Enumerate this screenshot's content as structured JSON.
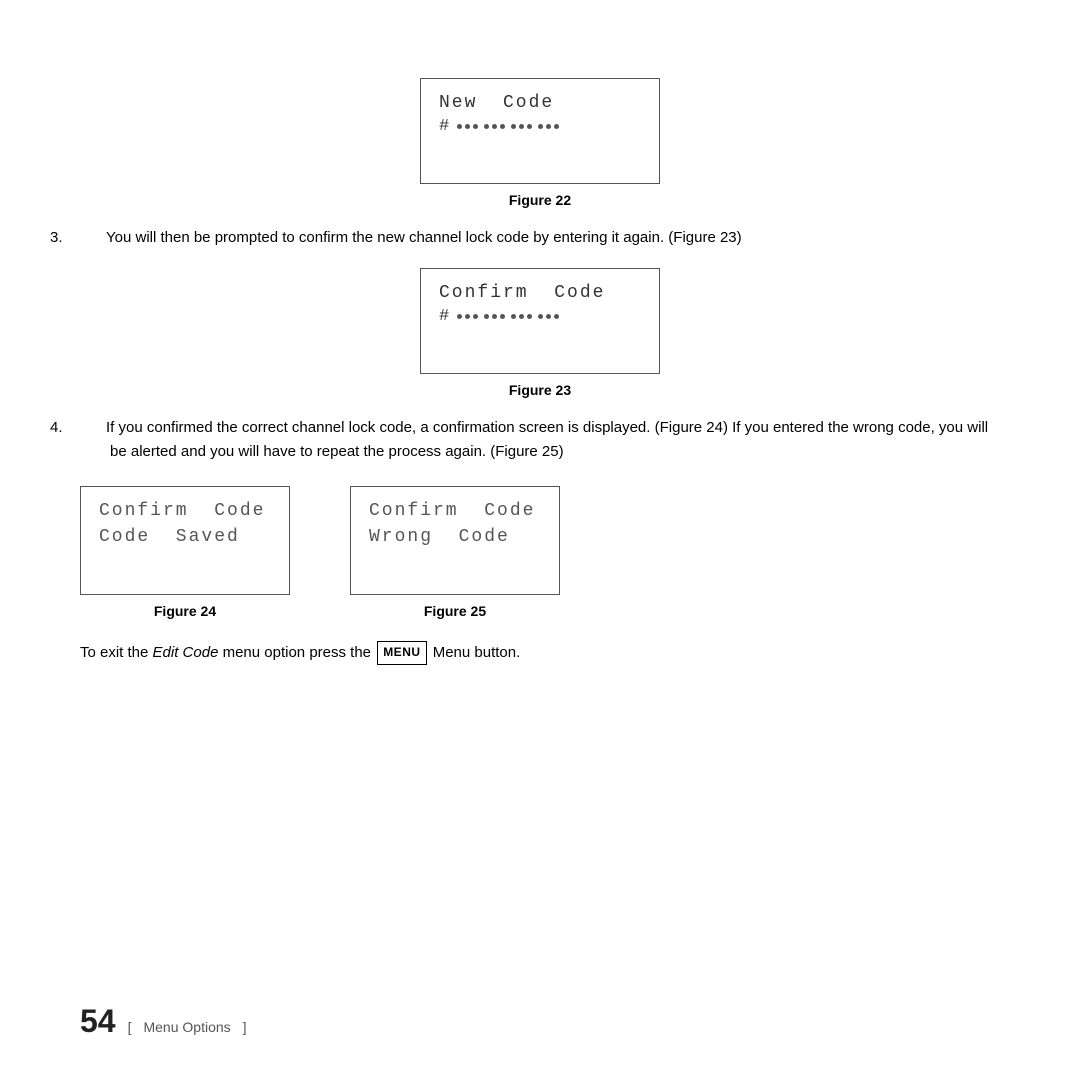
{
  "page": {
    "figures": {
      "fig22": {
        "label": "Figure 22",
        "screen": {
          "line1": "New  Code",
          "line2_hash": "#",
          "line2_dots": [
            3,
            3,
            3,
            3
          ]
        }
      },
      "fig23": {
        "label": "Figure 23",
        "screen": {
          "line1": "Confirm  Code",
          "line2_hash": "#",
          "line2_dots": [
            3,
            3,
            3,
            3
          ]
        }
      },
      "fig24": {
        "label": "Figure 24",
        "screen": {
          "line1": "Confirm  Code",
          "line2": "Code  Saved"
        }
      },
      "fig25": {
        "label": "Figure 25",
        "screen": {
          "line1": "Confirm  Code",
          "line2": "Wrong  Code"
        }
      }
    },
    "steps": {
      "step3": {
        "number": "3.",
        "text": "You will then be prompted to confirm the new channel lock code by entering it again. (Figure 23)"
      },
      "step4": {
        "number": "4.",
        "text": "If you confirmed the correct channel lock code, a confirmation screen is displayed. (Figure 24) If you entered the wrong code, you will be alerted and you will have to repeat the process again. (Figure 25)"
      }
    },
    "bottom_text": {
      "prefix": "To exit the ",
      "italic": "Edit Code",
      "middle": " menu option press the ",
      "menu_badge": "MENU",
      "suffix": " Menu button."
    },
    "footer": {
      "page_number": "54",
      "bracket_open": "[",
      "section_label": "Menu Options",
      "bracket_close": "]"
    }
  }
}
